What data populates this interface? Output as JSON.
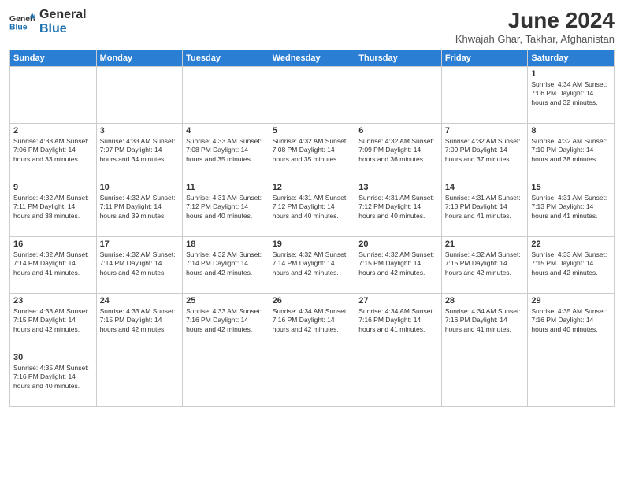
{
  "logo": {
    "line1": "General",
    "line2": "Blue"
  },
  "title": "June 2024",
  "subtitle": "Khwajah Ghar, Takhar, Afghanistan",
  "days_of_week": [
    "Sunday",
    "Monday",
    "Tuesday",
    "Wednesday",
    "Thursday",
    "Friday",
    "Saturday"
  ],
  "weeks": [
    [
      {
        "day": "",
        "info": ""
      },
      {
        "day": "",
        "info": ""
      },
      {
        "day": "",
        "info": ""
      },
      {
        "day": "",
        "info": ""
      },
      {
        "day": "",
        "info": ""
      },
      {
        "day": "",
        "info": ""
      },
      {
        "day": "1",
        "info": "Sunrise: 4:34 AM\nSunset: 7:06 PM\nDaylight: 14 hours\nand 32 minutes."
      }
    ],
    [
      {
        "day": "2",
        "info": "Sunrise: 4:33 AM\nSunset: 7:06 PM\nDaylight: 14 hours\nand 33 minutes."
      },
      {
        "day": "3",
        "info": "Sunrise: 4:33 AM\nSunset: 7:07 PM\nDaylight: 14 hours\nand 34 minutes."
      },
      {
        "day": "4",
        "info": "Sunrise: 4:33 AM\nSunset: 7:08 PM\nDaylight: 14 hours\nand 35 minutes."
      },
      {
        "day": "5",
        "info": "Sunrise: 4:32 AM\nSunset: 7:08 PM\nDaylight: 14 hours\nand 35 minutes."
      },
      {
        "day": "6",
        "info": "Sunrise: 4:32 AM\nSunset: 7:09 PM\nDaylight: 14 hours\nand 36 minutes."
      },
      {
        "day": "7",
        "info": "Sunrise: 4:32 AM\nSunset: 7:09 PM\nDaylight: 14 hours\nand 37 minutes."
      },
      {
        "day": "8",
        "info": "Sunrise: 4:32 AM\nSunset: 7:10 PM\nDaylight: 14 hours\nand 38 minutes."
      }
    ],
    [
      {
        "day": "9",
        "info": "Sunrise: 4:32 AM\nSunset: 7:11 PM\nDaylight: 14 hours\nand 38 minutes."
      },
      {
        "day": "10",
        "info": "Sunrise: 4:32 AM\nSunset: 7:11 PM\nDaylight: 14 hours\nand 39 minutes."
      },
      {
        "day": "11",
        "info": "Sunrise: 4:31 AM\nSunset: 7:12 PM\nDaylight: 14 hours\nand 40 minutes."
      },
      {
        "day": "12",
        "info": "Sunrise: 4:31 AM\nSunset: 7:12 PM\nDaylight: 14 hours\nand 40 minutes."
      },
      {
        "day": "13",
        "info": "Sunrise: 4:31 AM\nSunset: 7:12 PM\nDaylight: 14 hours\nand 40 minutes."
      },
      {
        "day": "14",
        "info": "Sunrise: 4:31 AM\nSunset: 7:13 PM\nDaylight: 14 hours\nand 41 minutes."
      },
      {
        "day": "15",
        "info": "Sunrise: 4:31 AM\nSunset: 7:13 PM\nDaylight: 14 hours\nand 41 minutes."
      }
    ],
    [
      {
        "day": "16",
        "info": "Sunrise: 4:32 AM\nSunset: 7:14 PM\nDaylight: 14 hours\nand 41 minutes."
      },
      {
        "day": "17",
        "info": "Sunrise: 4:32 AM\nSunset: 7:14 PM\nDaylight: 14 hours\nand 42 minutes."
      },
      {
        "day": "18",
        "info": "Sunrise: 4:32 AM\nSunset: 7:14 PM\nDaylight: 14 hours\nand 42 minutes."
      },
      {
        "day": "19",
        "info": "Sunrise: 4:32 AM\nSunset: 7:14 PM\nDaylight: 14 hours\nand 42 minutes."
      },
      {
        "day": "20",
        "info": "Sunrise: 4:32 AM\nSunset: 7:15 PM\nDaylight: 14 hours\nand 42 minutes."
      },
      {
        "day": "21",
        "info": "Sunrise: 4:32 AM\nSunset: 7:15 PM\nDaylight: 14 hours\nand 42 minutes."
      },
      {
        "day": "22",
        "info": "Sunrise: 4:33 AM\nSunset: 7:15 PM\nDaylight: 14 hours\nand 42 minutes."
      }
    ],
    [
      {
        "day": "23",
        "info": "Sunrise: 4:33 AM\nSunset: 7:15 PM\nDaylight: 14 hours\nand 42 minutes."
      },
      {
        "day": "24",
        "info": "Sunrise: 4:33 AM\nSunset: 7:15 PM\nDaylight: 14 hours\nand 42 minutes."
      },
      {
        "day": "25",
        "info": "Sunrise: 4:33 AM\nSunset: 7:16 PM\nDaylight: 14 hours\nand 42 minutes."
      },
      {
        "day": "26",
        "info": "Sunrise: 4:34 AM\nSunset: 7:16 PM\nDaylight: 14 hours\nand 42 minutes."
      },
      {
        "day": "27",
        "info": "Sunrise: 4:34 AM\nSunset: 7:16 PM\nDaylight: 14 hours\nand 41 minutes."
      },
      {
        "day": "28",
        "info": "Sunrise: 4:34 AM\nSunset: 7:16 PM\nDaylight: 14 hours\nand 41 minutes."
      },
      {
        "day": "29",
        "info": "Sunrise: 4:35 AM\nSunset: 7:16 PM\nDaylight: 14 hours\nand 40 minutes."
      }
    ],
    [
      {
        "day": "30",
        "info": "Sunrise: 4:35 AM\nSunset: 7:16 PM\nDaylight: 14 hours\nand 40 minutes."
      },
      {
        "day": "",
        "info": ""
      },
      {
        "day": "",
        "info": ""
      },
      {
        "day": "",
        "info": ""
      },
      {
        "day": "",
        "info": ""
      },
      {
        "day": "",
        "info": ""
      },
      {
        "day": "",
        "info": ""
      }
    ]
  ]
}
